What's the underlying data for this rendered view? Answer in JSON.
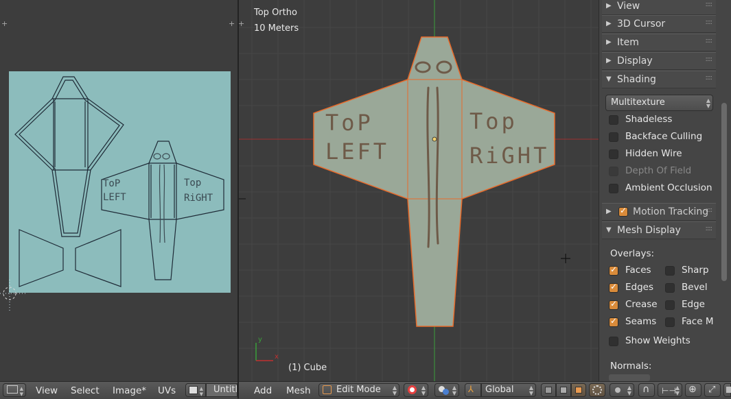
{
  "uv_editor": {
    "header": {
      "menus": [
        "View",
        "Select",
        "Image*",
        "UVs"
      ],
      "image_name": "Untitle"
    },
    "texture": {
      "background_color": "#8cbcbc",
      "left_wing_text": [
        "ToP",
        "LEFT"
      ],
      "right_wing_text": [
        "Top",
        "RiGHT"
      ]
    }
  },
  "viewport": {
    "view_label": "Top Ortho",
    "scale_label": "10 Meters",
    "object_label": "(1) Cube",
    "left_wing_text": [
      "ToP",
      "LEFT"
    ],
    "right_wing_text": [
      "Top",
      "RiGHT"
    ],
    "axis_x": "x",
    "axis_y": "y",
    "header": {
      "menus": [
        "Add",
        "Mesh"
      ],
      "mode": "Edit Mode",
      "orientation": "Global"
    },
    "colors": {
      "edge_selected": "#e86a2a",
      "x_axis": "#a03030",
      "y_axis": "#3aa03a",
      "mesh_fill": "#9aa898"
    }
  },
  "properties": {
    "sections": [
      {
        "label": "View",
        "expanded": false
      },
      {
        "label": "3D Cursor",
        "expanded": false
      },
      {
        "label": "Item",
        "expanded": false
      },
      {
        "label": "Display",
        "expanded": false
      },
      {
        "label": "Shading",
        "expanded": true
      },
      {
        "label": "Motion Tracking",
        "expanded": false
      },
      {
        "label": "Mesh Display",
        "expanded": true
      }
    ],
    "shading": {
      "dropdown": "Multitexture",
      "options": [
        {
          "label": "Shadeless",
          "checked": false
        },
        {
          "label": "Backface Culling",
          "checked": false
        },
        {
          "label": "Hidden Wire",
          "checked": false
        },
        {
          "label": "Depth Of Field",
          "checked": false,
          "disabled": true
        },
        {
          "label": "Ambient Occlusion",
          "checked": false
        }
      ]
    },
    "motion_tracking_checked": true,
    "mesh_display": {
      "overlays_label": "Overlays:",
      "left": [
        {
          "label": "Faces",
          "checked": true
        },
        {
          "label": "Edges",
          "checked": true
        },
        {
          "label": "Crease",
          "checked": true
        },
        {
          "label": "Seams",
          "checked": true
        }
      ],
      "right": [
        {
          "label": "Sharp",
          "checked": false
        },
        {
          "label": "Bevel",
          "checked": false
        },
        {
          "label": "Edge",
          "checked": false
        },
        {
          "label": "Face M",
          "checked": false
        }
      ],
      "show_weights": {
        "label": "Show Weights",
        "checked": false
      },
      "normals_label": "Normals:"
    },
    "accent_color": "#d98b3a"
  }
}
